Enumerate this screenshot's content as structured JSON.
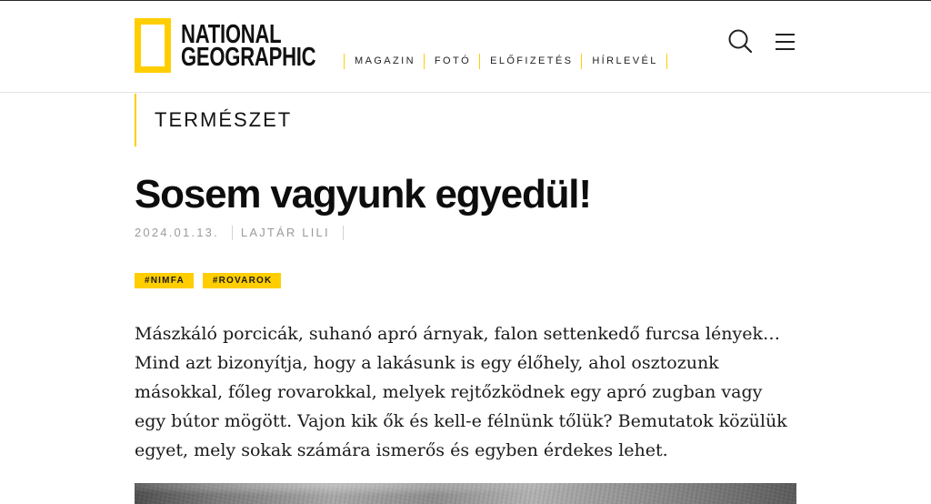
{
  "colors": {
    "brand_yellow": "#ffce00",
    "text": "#111111",
    "meta_gray": "#9b9b9b",
    "divider": "#e4e4e4"
  },
  "header": {
    "logo": {
      "line1": "NATIONAL",
      "line2": "GEOGRAPHIC"
    },
    "nav": {
      "items": [
        {
          "label": "MAGAZIN"
        },
        {
          "label": "FOTÓ"
        },
        {
          "label": "ELŐFIZETÉS"
        },
        {
          "label": "HÍRLEVÉL"
        }
      ]
    },
    "icons": {
      "search": "search-icon",
      "menu": "hamburger-menu-icon"
    }
  },
  "article": {
    "category": "TERMÉSZET",
    "title": "Sosem vagyunk egyedül!",
    "meta": {
      "date": "2024.01.13.",
      "author": "LAJTÁR LILI"
    },
    "tags": [
      "#NIMFA",
      "#ROVAROK"
    ],
    "lead": "Mászkáló porcicák, suhanó apró árnyak, falon settenkedő furcsa lények… Mind azt bizonyítja, hogy a lakásunk is egy élőhely, ahol osztozunk másokkal, főleg rovarokkal, melyek rejtőzködnek egy apró zugban vagy egy bútor mögött. Vajon kik ők és kell-e félnünk tőlük? Bemutatok közülük egyet, mely sokak számára ismerős és egyben érdekes lehet."
  }
}
